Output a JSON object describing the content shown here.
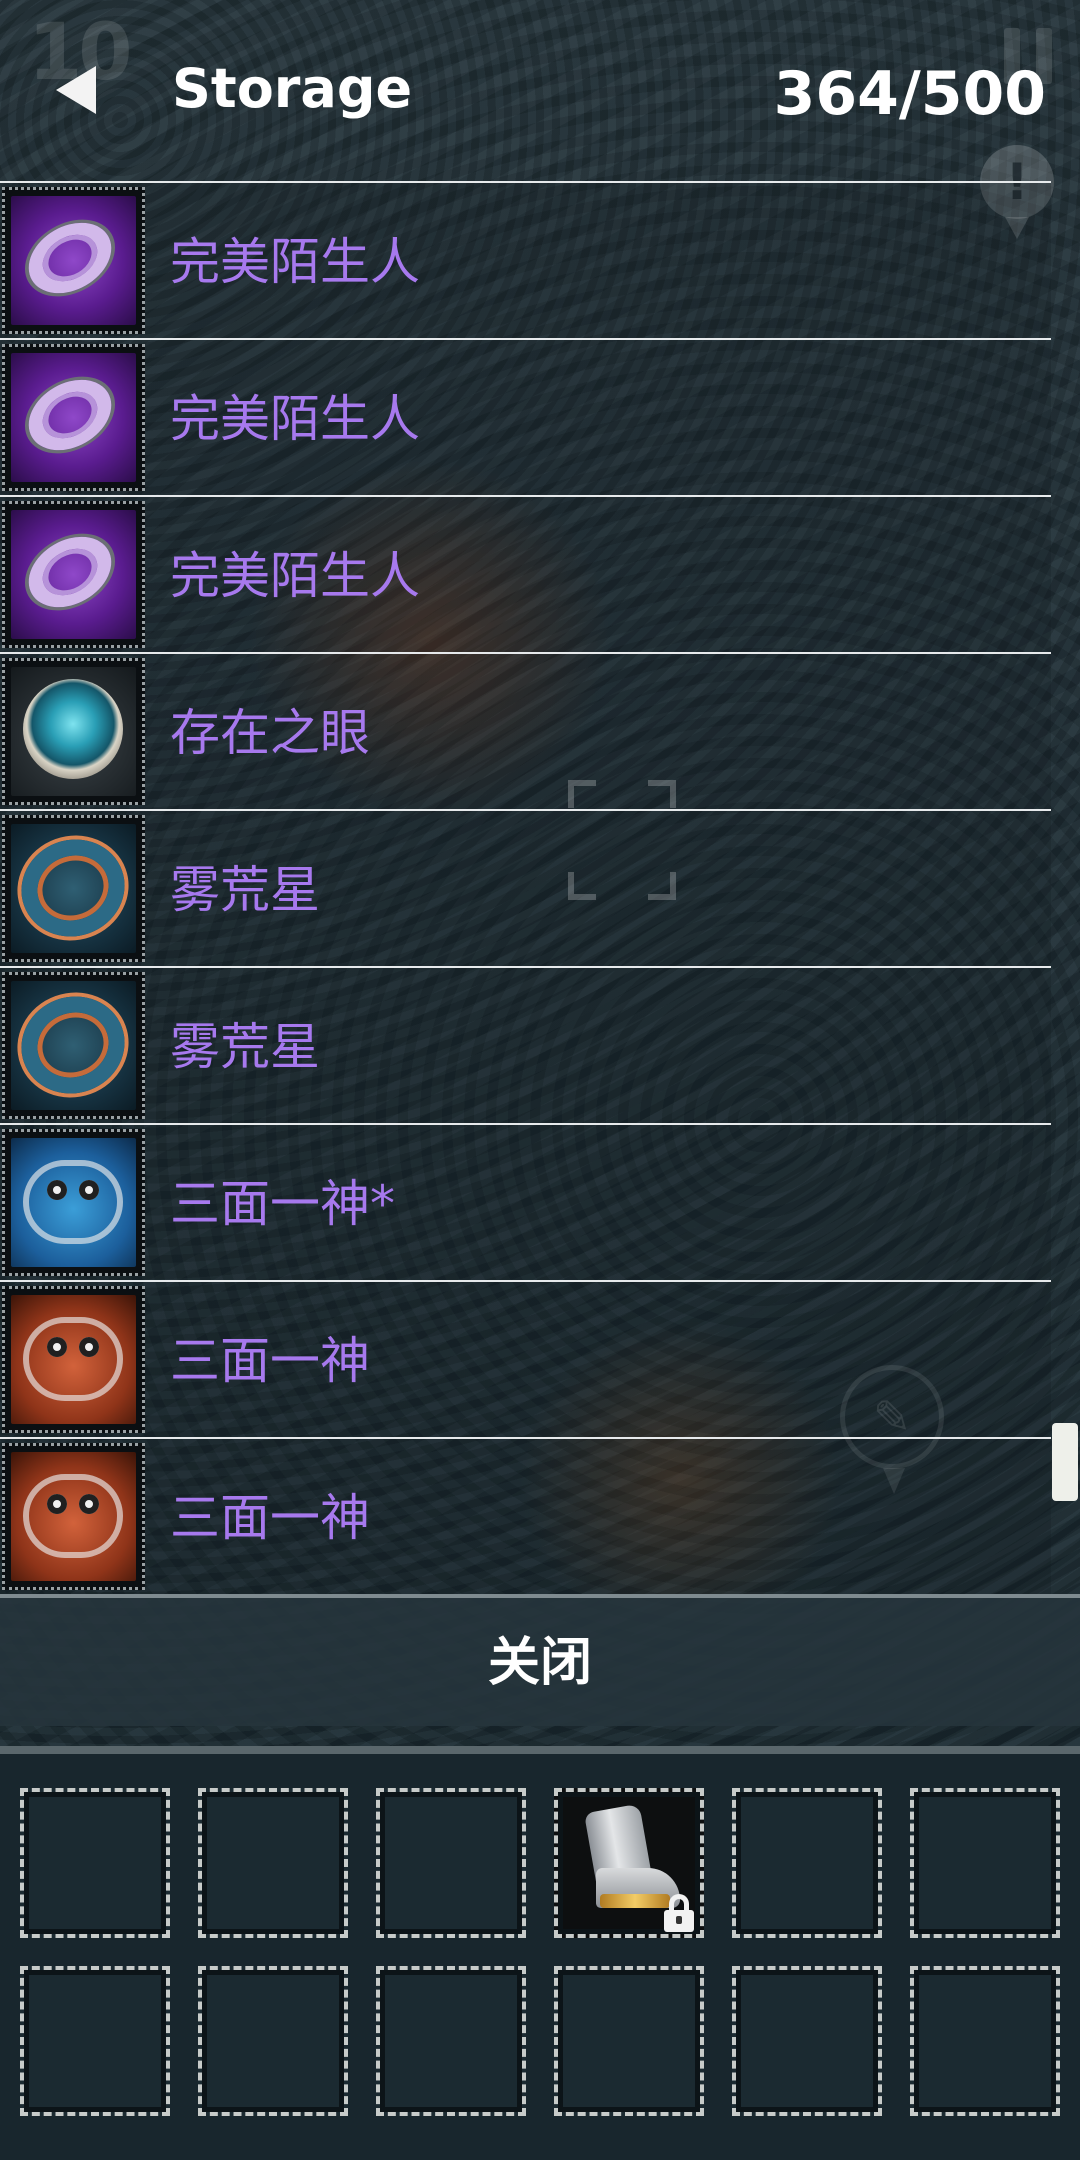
{
  "hud": {
    "counter": "10",
    "chat_glyph": "✎",
    "alert_glyph": "!"
  },
  "header": {
    "title": "Storage",
    "count": "364/500",
    "back_icon": "back-triangle-icon"
  },
  "items": [
    {
      "name": "完美陌生人",
      "icon": "purple-ring-icon"
    },
    {
      "name": "完美陌生人",
      "icon": "purple-ring-icon"
    },
    {
      "name": "完美陌生人",
      "icon": "purple-ring-icon"
    },
    {
      "name": "存在之眼",
      "icon": "eye-amulet-icon"
    },
    {
      "name": "雾荒星",
      "icon": "teal-ring-icon"
    },
    {
      "name": "雾荒星",
      "icon": "teal-ring-icon"
    },
    {
      "name": "三面一神*",
      "icon": "blue-mask-icon"
    },
    {
      "name": "三面一神",
      "icon": "red-mask-icon"
    },
    {
      "name": "三面一神",
      "icon": "red-mask-icon"
    }
  ],
  "item_name_color": "#a779ee",
  "close_label": "关闭",
  "inventory": {
    "slots": [
      {
        "item": null
      },
      {
        "item": null
      },
      {
        "item": null
      },
      {
        "item": "boots-icon",
        "locked": true
      },
      {
        "item": null
      },
      {
        "item": null
      },
      {
        "item": null
      },
      {
        "item": null
      },
      {
        "item": null
      },
      {
        "item": null
      },
      {
        "item": null
      },
      {
        "item": null
      }
    ]
  }
}
